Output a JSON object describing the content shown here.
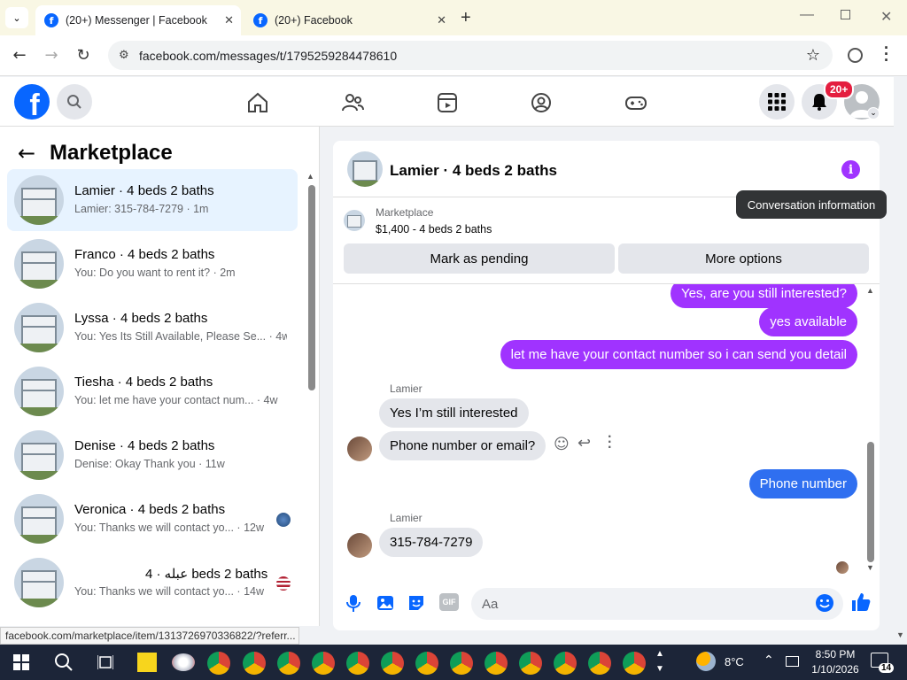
{
  "browser": {
    "tabs": [
      {
        "title": "(20+) Messenger | Facebook",
        "active": true
      },
      {
        "title": "(20+) Facebook",
        "active": false
      }
    ],
    "url": "facebook.com/messages/t/1795259284478610",
    "status_url": "facebook.com/marketplace/item/1313726970336822/?referr..."
  },
  "header": {
    "logo": "f",
    "notif_badge": "20+"
  },
  "left_panel": {
    "title": "Marketplace",
    "conversations": [
      {
        "name": "Lamier · 4 beds 2 baths",
        "preview": "Lamier: 315-784-7279 · 1m"
      },
      {
        "name": "Franco · 4 beds 2 baths",
        "preview": "You: Do you want to rent it? · 2m"
      },
      {
        "name": "Lyssa · 4 beds 2 baths",
        "preview": "You: Yes Its Still Available, Please Se... · 4w"
      },
      {
        "name": "Tiesha · 4 beds 2 baths",
        "preview": "You: let me have your contact num... · 4w"
      },
      {
        "name": "Denise · 4 beds 2 baths",
        "preview": "Denise: Okay Thank you · 11w"
      },
      {
        "name": "Veronica · 4 beds 2 baths",
        "preview": "You: Thanks we will contact yo... · 12w"
      },
      {
        "name": "عبله · 4 beds 2 baths",
        "preview": "You: Thanks we will contact yo... · 14w"
      }
    ]
  },
  "chat": {
    "title": "Lamier · 4 beds 2 baths",
    "tooltip": "Conversation information",
    "marketplace_label": "Marketplace",
    "listing": "$1,400 - 4 beds 2 baths",
    "mark_pending": "Mark as pending",
    "more_options": "More options",
    "messages": {
      "m1": "Yes, are you still interested?",
      "m2": "yes available",
      "m3": "let me have your contact number so i can send you detail",
      "sender1": "Lamier",
      "m4": "Yes I’m still interested",
      "m5": "Phone number or email?",
      "m6": "Phone number",
      "sender2": "Lamier",
      "m7": "315-784-7279"
    },
    "composer_placeholder": "Aa",
    "gif_label": "GIF"
  },
  "taskbar": {
    "temperature": "8°C",
    "time": "8:50 PM",
    "date": "1/10/2026",
    "notifications": "14"
  },
  "colors": {
    "fb_blue": "#0866ff",
    "purple": "#a033ff",
    "selected_bg": "#e7f3ff"
  }
}
